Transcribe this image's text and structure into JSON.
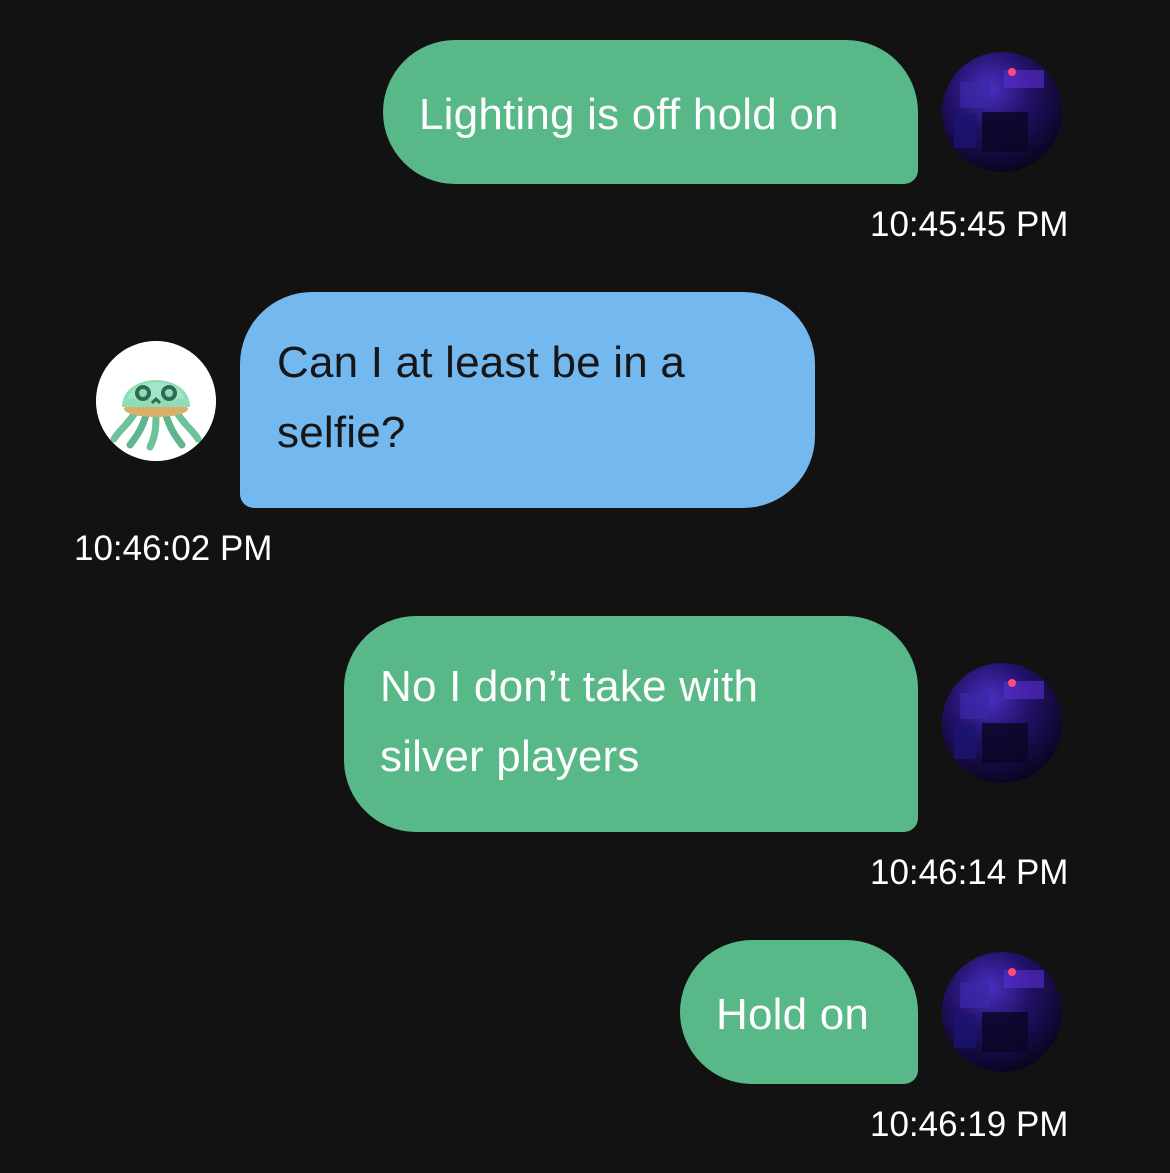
{
  "messages": [
    {
      "sender": "me",
      "text": "Lighting is off hold on",
      "time": "10:45:45 PM"
    },
    {
      "sender": "other",
      "lines": [
        "Can I at least be in a",
        "selfie?"
      ],
      "time": "10:46:02 PM"
    },
    {
      "sender": "me",
      "lines": [
        "No I don’t take with",
        "silver players"
      ],
      "time": "10:46:14 PM"
    },
    {
      "sender": "me",
      "text": "Hold on",
      "time": "10:46:19 PM"
    }
  ],
  "colors": {
    "background": "#121212",
    "my_bubble": "#58b887",
    "their_bubble": "#74b8f0",
    "timestamp": "#ffffff"
  },
  "avatars": {
    "me": "dark-purple-photo-avatar",
    "other": "green-jellyfish-avatar"
  }
}
